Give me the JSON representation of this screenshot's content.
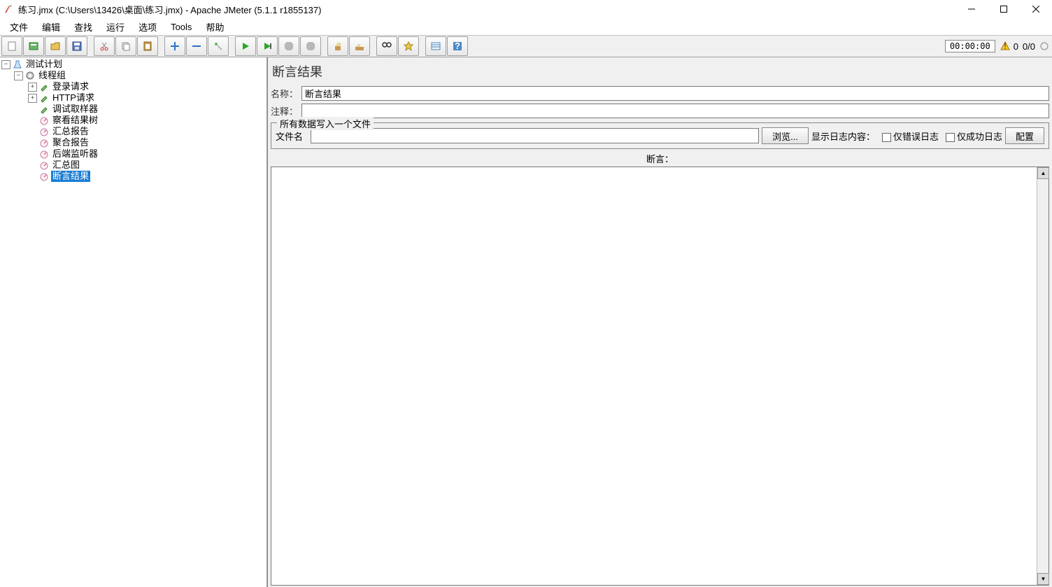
{
  "window": {
    "title": "练习.jmx (C:\\Users\\13426\\桌面\\练习.jmx) - Apache JMeter (5.1.1 r1855137)"
  },
  "menu": {
    "file": "文件",
    "edit": "编辑",
    "search": "查找",
    "run": "运行",
    "options": "选项",
    "tools": "Tools",
    "help": "帮助"
  },
  "toolbar": {
    "timer": "00:00:00",
    "warn_count": "0",
    "thread_counts": "0/0"
  },
  "tree": {
    "test_plan": "测试计划",
    "thread_group": "线程组",
    "login_req": "登录请求",
    "http_req": "HTTP请求",
    "debug_sampler": "调试取样器",
    "view_results_tree": "察看结果树",
    "summary_report": "汇总报告",
    "aggregate_report": "聚合报告",
    "backend_listener": "后端监听器",
    "summary_graph": "汇总图",
    "assertion_results": "断言结果"
  },
  "panel": {
    "title": "断言结果",
    "name_label": "名称：",
    "name_value": "断言结果",
    "comment_label": "注释：",
    "comment_value": "",
    "file_group_legend": "所有数据写入一个文件",
    "file_label": "文件名",
    "file_value": "",
    "browse_button": "浏览...",
    "show_log_label": "显示日志内容：",
    "only_error_label": "仅错误日志",
    "only_success_label": "仅成功日志",
    "config_button": "配置",
    "assert_label": "断言："
  }
}
